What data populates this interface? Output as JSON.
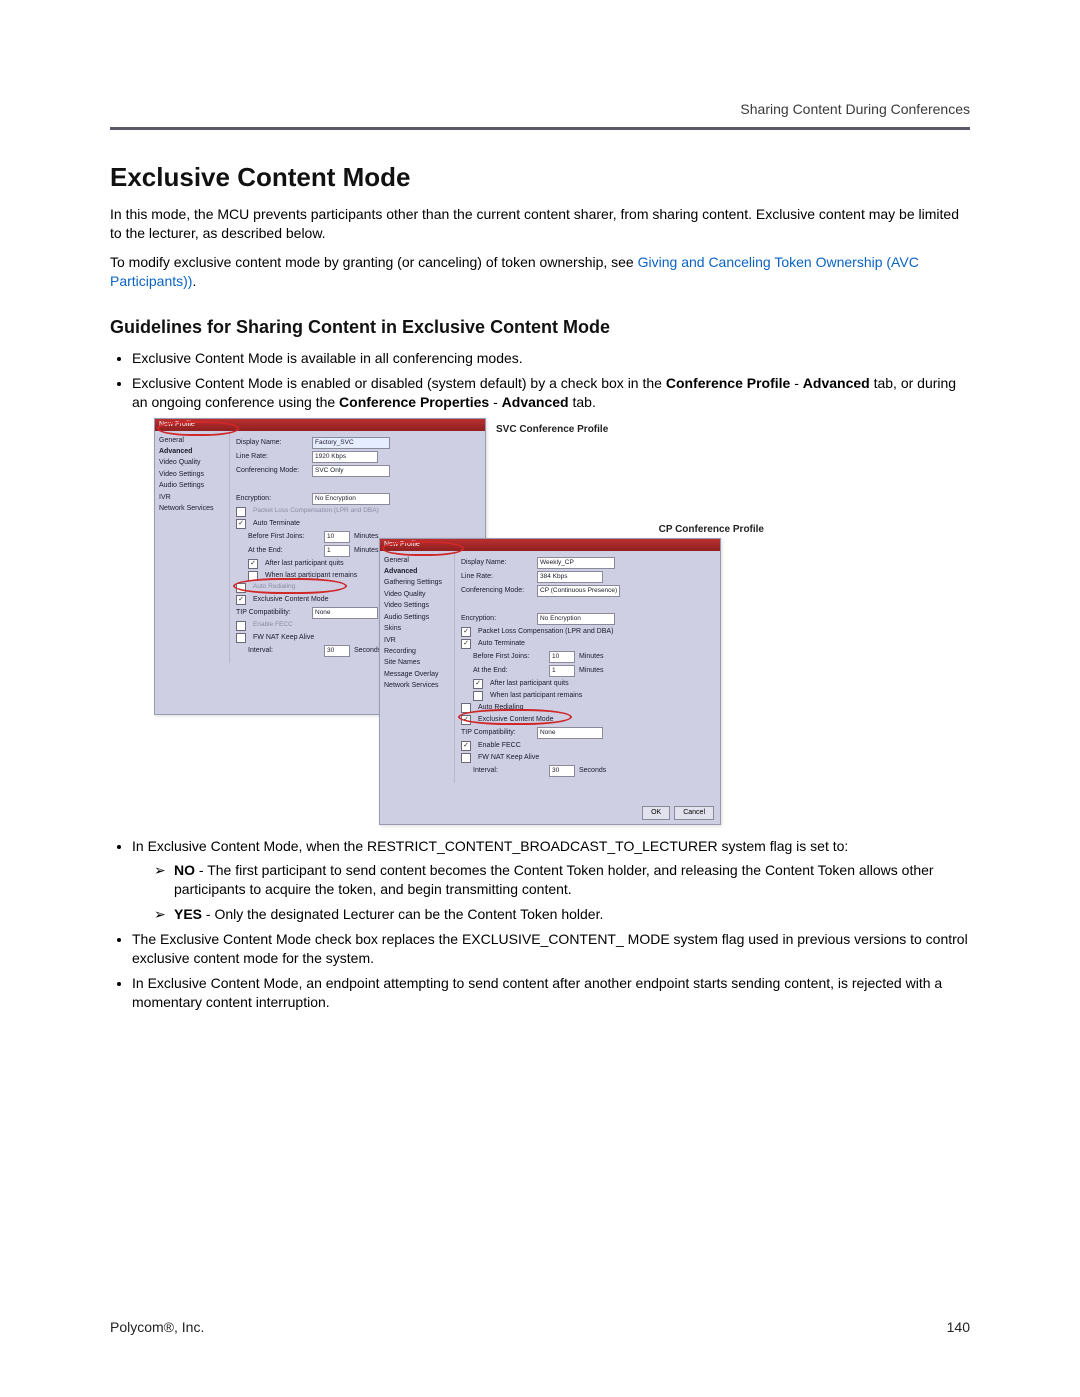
{
  "header": {
    "running": "Sharing Content During Conferences"
  },
  "h1": "Exclusive Content Mode",
  "intro1": "In this mode, the MCU prevents participants other than the current content sharer, from sharing content. Exclusive content may be limited to the lecturer, as described below.",
  "intro2a": "To modify exclusive content mode by granting (or canceling) of token ownership, see ",
  "intro2_link": "Giving and Canceling Token Ownership (AVC Participants))",
  "intro2b": ".",
  "h2": "Guidelines for Sharing Content in Exclusive Content Mode",
  "b1": "Exclusive Content Mode is available in all conferencing modes.",
  "b2a": "Exclusive Content Mode is enabled or disabled (system default) by a check box in the ",
  "b2_s1": "Conference Profile",
  "b2b": " - ",
  "b2_s2": "Advanced",
  "b2c": " tab, or during an ongoing conference using the ",
  "b2_s3": "Conference Properties",
  "b2d": " - ",
  "b2_s4": "Advanced",
  "b2e": " tab.",
  "b3": "In Exclusive Content Mode, when the RESTRICT_CONTENT_BROADCAST_TO_LECTURER system flag is set to:",
  "b3_no_label": "NO",
  "b3_no": " - The first participant to send content becomes the Content Token holder, and releasing the Content Token allows other participants to acquire the token, and begin transmitting content.",
  "b3_yes_label": "YES",
  "b3_yes": " - Only the designated Lecturer can be the Content Token holder.",
  "b4": "The Exclusive Content Mode check box replaces the EXCLUSIVE_CONTENT_ MODE system flag used in previous versions to control exclusive content mode for the system.",
  "b5": "In Exclusive Content Mode, an endpoint attempting to send content after another endpoint starts sending content, is rejected with a momentary content interruption.",
  "footer": {
    "left": "Polycom®, Inc.",
    "right": "140"
  },
  "fig": {
    "svc_caption": "SVC  Conference Profile",
    "cp_caption": "CP  Conference Profile",
    "title": "New Profile",
    "ok": "OK",
    "cancel": "Cancel",
    "svc": {
      "nav": [
        "General",
        "Advanced",
        "Video Quality",
        "Video Settings",
        "Audio Settings",
        "IVR",
        "Network Services"
      ],
      "display_name_lbl": "Display Name:",
      "display_name": "Factory_SVC",
      "line_rate_lbl": "Line Rate:",
      "line_rate": "1920 Kbps",
      "conf_mode_lbl": "Conferencing Mode:",
      "conf_mode": "SVC Only",
      "encryption_lbl": "Encryption:",
      "encryption": "No Encryption",
      "plc": "Packet Loss Compensation (LPR and DBA)",
      "auto_term": "Auto Terminate",
      "before_lbl": "Before First Joins:",
      "before_val": "10",
      "end_lbl": "At the End:",
      "end_val": "1",
      "after_quits": "After last participant quits",
      "when_remains": "When last participant remains",
      "auto_redial": "Auto Redialing",
      "exclusive": "Exclusive Content Mode",
      "tip_lbl": "TIP Compatibility:",
      "tip": "None",
      "enable_fecc": "Enable FECC",
      "fw_nat": "FW NAT Keep Alive",
      "interval_lbl": "Interval:",
      "interval_val": "30",
      "seconds": "Seconds",
      "minutes": "Minutes"
    },
    "cp": {
      "nav": [
        "General",
        "Advanced",
        "Gathering Settings",
        "Video Quality",
        "Video Settings",
        "Audio Settings",
        "Skins",
        "IVR",
        "Recording",
        "Site Names",
        "Message Overlay",
        "Network Services"
      ],
      "display_name_lbl": "Display Name:",
      "display_name": "Weekly_CP",
      "line_rate_lbl": "Line Rate:",
      "line_rate": "384 Kbps",
      "conf_mode_lbl": "Conferencing Mode:",
      "conf_mode": "CP (Continuous Presence)",
      "encryption_lbl": "Encryption:",
      "encryption": "No Encryption",
      "plc": "Packet Loss Compensation (LPR and DBA)",
      "auto_term": "Auto Terminate",
      "before_lbl": "Before First Joins:",
      "before_val": "10",
      "end_lbl": "At the End:",
      "end_val": "1",
      "after_quits": "After last participant quits",
      "when_remains": "When last participant remains",
      "auto_redial": "Auto Redialing",
      "exclusive": "Exclusive Content Mode",
      "tip_lbl": "TIP Compatibility:",
      "tip": "None",
      "enable_fecc": "Enable FECC",
      "fw_nat": "FW NAT Keep Alive",
      "interval_lbl": "Interval:",
      "interval_val": "30",
      "seconds": "Seconds",
      "minutes": "Minutes"
    }
  }
}
